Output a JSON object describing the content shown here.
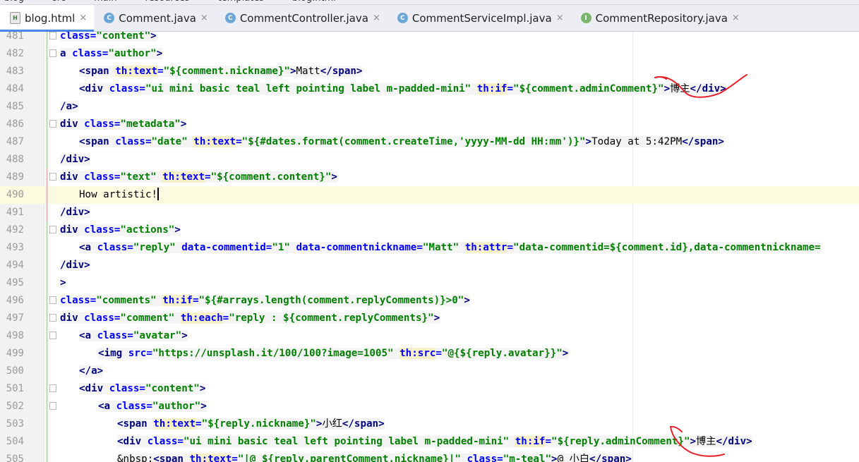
{
  "breadcrumbs": [
    "blog",
    "src",
    "main",
    "resources",
    "templates",
    "blog.html"
  ],
  "tabs": [
    {
      "label": "blog.html",
      "icon": "html-file-icon",
      "type": "h",
      "active": true
    },
    {
      "label": "Comment.java",
      "icon": "class-icon",
      "type": "c",
      "active": false
    },
    {
      "label": "CommentController.java",
      "icon": "class-icon",
      "type": "c",
      "active": false
    },
    {
      "label": "CommentServiceImpl.java",
      "icon": "class-icon",
      "type": "c",
      "active": false
    },
    {
      "label": "CommentRepository.java",
      "icon": "interface-icon",
      "type": "i",
      "active": false
    }
  ],
  "icon_letters": {
    "c": "C",
    "i": "I",
    "h": "H"
  },
  "close_glyph": "×",
  "colors": {
    "tag": "#000080",
    "attribute": "#0000ff",
    "value": "#008000",
    "active_tab_indicator": "#4a86e8",
    "annotation": "#e8202a"
  },
  "current_line": 490,
  "lines": [
    {
      "num": "481",
      "indent": 0,
      "mark": "g",
      "fold": true,
      "tokens": [
        [
          "attr",
          "class="
        ],
        [
          "val",
          "\"content\""
        ],
        [
          "tag",
          ">"
        ]
      ]
    },
    {
      "num": "482",
      "indent": 0,
      "mark": "g",
      "fold": true,
      "tokens": [
        [
          "tag",
          "a "
        ],
        [
          "attr",
          "class="
        ],
        [
          "val",
          "\"author\""
        ],
        [
          "tag",
          ">"
        ]
      ]
    },
    {
      "num": "483",
      "indent": 1,
      "mark": "g",
      "fold": false,
      "tokens": [
        [
          "tag",
          "<span "
        ],
        [
          "th",
          "th:text"
        ],
        [
          "attr",
          "="
        ],
        [
          "val",
          "\"${comment.nickname}\""
        ],
        [
          "tag",
          ">"
        ],
        [
          "plain",
          "Matt"
        ],
        [
          "tag",
          "</span>"
        ]
      ]
    },
    {
      "num": "484",
      "indent": 1,
      "mark": "g",
      "fold": false,
      "tokens": [
        [
          "tag",
          "<div "
        ],
        [
          "attr",
          "class="
        ],
        [
          "val",
          "\"ui mini basic teal left pointing label m-padded-mini\" "
        ],
        [
          "th",
          "th:if"
        ],
        [
          "attr",
          "="
        ],
        [
          "val",
          "\"${comment.adminComment}\""
        ],
        [
          "tag",
          ">"
        ],
        [
          "plain",
          "博主"
        ],
        [
          "tag",
          "</div>"
        ]
      ]
    },
    {
      "num": "485",
      "indent": 0,
      "mark": "g",
      "fold": false,
      "tokens": [
        [
          "tag",
          "/a>"
        ]
      ]
    },
    {
      "num": "486",
      "indent": 0,
      "mark": "g",
      "fold": true,
      "tokens": [
        [
          "tag",
          "div "
        ],
        [
          "attr",
          "class="
        ],
        [
          "val",
          "\"metadata\""
        ],
        [
          "tag",
          ">"
        ]
      ]
    },
    {
      "num": "487",
      "indent": 1,
      "mark": "g",
      "fold": false,
      "tokens": [
        [
          "tag",
          "<span "
        ],
        [
          "attr",
          "class="
        ],
        [
          "val",
          "\"date\" "
        ],
        [
          "th",
          "th:text"
        ],
        [
          "attr",
          "="
        ],
        [
          "val",
          "\"${#dates.format(comment.createTime,'yyyy-MM-dd HH:mm')}\""
        ],
        [
          "tag",
          ">"
        ],
        [
          "plain",
          "Today at 5:42PM"
        ],
        [
          "tag",
          "</span>"
        ]
      ]
    },
    {
      "num": "488",
      "indent": 0,
      "mark": "g",
      "fold": false,
      "tokens": [
        [
          "tag",
          "/div>"
        ]
      ]
    },
    {
      "num": "489",
      "indent": 0,
      "mark": "r",
      "fold": true,
      "tokens": [
        [
          "tag",
          "div "
        ],
        [
          "attr",
          "class="
        ],
        [
          "val",
          "\"text\" "
        ],
        [
          "th",
          "th:text"
        ],
        [
          "attr",
          "="
        ],
        [
          "val",
          "\"${comment.content}\""
        ],
        [
          "tag",
          ">"
        ]
      ]
    },
    {
      "num": "490",
      "indent": 1,
      "mark": "r",
      "fold": false,
      "current": true,
      "tokens": [
        [
          "plain",
          "How artistic!"
        ]
      ]
    },
    {
      "num": "491",
      "indent": 0,
      "mark": "r",
      "fold": false,
      "tokens": [
        [
          "tag",
          "/div>"
        ]
      ]
    },
    {
      "num": "492",
      "indent": 0,
      "mark": "g",
      "fold": true,
      "tokens": [
        [
          "tag",
          "div "
        ],
        [
          "attr",
          "class="
        ],
        [
          "val",
          "\"actions\""
        ],
        [
          "tag",
          ">"
        ]
      ]
    },
    {
      "num": "493",
      "indent": 1,
      "mark": "g",
      "fold": false,
      "tokens": [
        [
          "tag",
          "<a "
        ],
        [
          "attr",
          "class="
        ],
        [
          "val",
          "\"reply\" "
        ],
        [
          "attr",
          "data-commentid="
        ],
        [
          "val",
          "\"1\" "
        ],
        [
          "attr",
          "data-commentnickname="
        ],
        [
          "val",
          "\"Matt\" "
        ],
        [
          "th",
          "th:attr"
        ],
        [
          "attr",
          "="
        ],
        [
          "val",
          "\"data-commentid=${comment.id},data-commentnickname="
        ]
      ]
    },
    {
      "num": "494",
      "indent": 0,
      "mark": "g",
      "fold": false,
      "tokens": [
        [
          "tag",
          "/div>"
        ]
      ]
    },
    {
      "num": "495",
      "indent": 0,
      "mark": "o",
      "fold": false,
      "tokens": [
        [
          "tag",
          ">"
        ]
      ]
    },
    {
      "num": "496",
      "indent": 0,
      "mark": "g",
      "fold": true,
      "tokens": [
        [
          "attr",
          "class="
        ],
        [
          "val",
          "\"comments\" "
        ],
        [
          "th",
          "th:if"
        ],
        [
          "attr",
          "="
        ],
        [
          "val",
          "\"${#arrays.length(comment.replyComments)}>0\""
        ],
        [
          "tag",
          ">"
        ]
      ]
    },
    {
      "num": "497",
      "indent": 0,
      "mark": "g",
      "fold": true,
      "tokens": [
        [
          "tag",
          "div "
        ],
        [
          "attr",
          "class="
        ],
        [
          "val",
          "\"comment\" "
        ],
        [
          "th",
          "th:each"
        ],
        [
          "attr",
          "="
        ],
        [
          "val",
          "\"reply : ${comment.replyComments}\""
        ],
        [
          "tag",
          ">"
        ]
      ]
    },
    {
      "num": "498",
      "indent": 1,
      "mark": "g",
      "fold": true,
      "tokens": [
        [
          "tag",
          "<a "
        ],
        [
          "attr",
          "class="
        ],
        [
          "val",
          "\"avatar\""
        ],
        [
          "tag",
          ">"
        ]
      ]
    },
    {
      "num": "499",
      "indent": 2,
      "mark": "g",
      "fold": false,
      "tokens": [
        [
          "tag",
          "<img "
        ],
        [
          "attr",
          "src="
        ],
        [
          "val",
          "\"https://unsplash.it/100/100?image=1005\" "
        ],
        [
          "th",
          "th:src"
        ],
        [
          "attr",
          "="
        ],
        [
          "val",
          "\"@{${reply.avatar}}\""
        ],
        [
          "tag",
          ">"
        ]
      ]
    },
    {
      "num": "500",
      "indent": 1,
      "mark": "g",
      "fold": false,
      "tokens": [
        [
          "tag",
          "</a>"
        ]
      ]
    },
    {
      "num": "501",
      "indent": 1,
      "mark": "g",
      "fold": true,
      "tokens": [
        [
          "tag",
          "<div "
        ],
        [
          "attr",
          "class="
        ],
        [
          "val",
          "\"content\""
        ],
        [
          "tag",
          ">"
        ]
      ]
    },
    {
      "num": "502",
      "indent": 2,
      "mark": "g",
      "fold": true,
      "tokens": [
        [
          "tag",
          "<a "
        ],
        [
          "attr",
          "class="
        ],
        [
          "val",
          "\"author\""
        ],
        [
          "tag",
          ">"
        ]
      ]
    },
    {
      "num": "503",
      "indent": 3,
      "mark": "g",
      "fold": false,
      "tokens": [
        [
          "tag",
          "<span "
        ],
        [
          "th",
          "th:text"
        ],
        [
          "attr",
          "="
        ],
        [
          "val",
          "\"${reply.nickname}\""
        ],
        [
          "tag",
          ">"
        ],
        [
          "plain",
          "小红"
        ],
        [
          "tag",
          "</span>"
        ]
      ]
    },
    {
      "num": "504",
      "indent": 3,
      "mark": "g",
      "fold": false,
      "tokens": [
        [
          "tag",
          "<div "
        ],
        [
          "attr",
          "class="
        ],
        [
          "val",
          "\"ui mini basic teal left pointing label m-padded-mini\" "
        ],
        [
          "th",
          "th:if"
        ],
        [
          "attr",
          "="
        ],
        [
          "val",
          "\"${reply.adminComment}\""
        ],
        [
          "tag",
          ">"
        ],
        [
          "plain",
          "博主"
        ],
        [
          "tag",
          "</div>"
        ]
      ]
    },
    {
      "num": "505",
      "indent": 3,
      "mark": "g",
      "fold": false,
      "tokens": [
        [
          "plain",
          "&nbsp;"
        ],
        [
          "tag",
          "<span "
        ],
        [
          "th",
          "th:text"
        ],
        [
          "attr",
          "="
        ],
        [
          "val",
          "\"|@ ${reply.parentComment.nickname}|\" "
        ],
        [
          "attr",
          "class="
        ],
        [
          "val",
          "\"m-teal\""
        ],
        [
          "tag",
          ">"
        ],
        [
          "plain",
          "@ 小白"
        ],
        [
          "tag",
          "</span>"
        ]
      ]
    }
  ]
}
